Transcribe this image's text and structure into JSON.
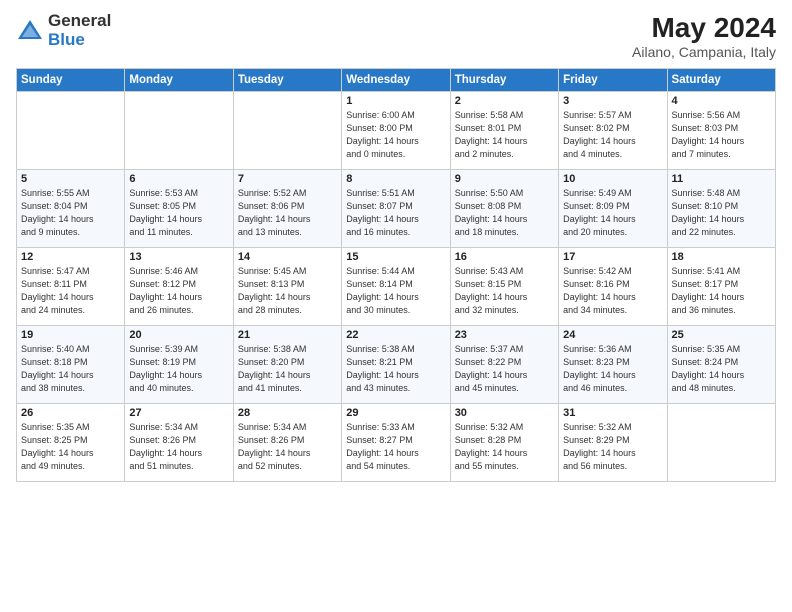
{
  "logo": {
    "general": "General",
    "blue": "Blue"
  },
  "title": "May 2024",
  "subtitle": "Ailano, Campania, Italy",
  "days_of_week": [
    "Sunday",
    "Monday",
    "Tuesday",
    "Wednesday",
    "Thursday",
    "Friday",
    "Saturday"
  ],
  "weeks": [
    [
      {
        "day": "",
        "info": ""
      },
      {
        "day": "",
        "info": ""
      },
      {
        "day": "",
        "info": ""
      },
      {
        "day": "1",
        "info": "Sunrise: 6:00 AM\nSunset: 8:00 PM\nDaylight: 14 hours\nand 0 minutes."
      },
      {
        "day": "2",
        "info": "Sunrise: 5:58 AM\nSunset: 8:01 PM\nDaylight: 14 hours\nand 2 minutes."
      },
      {
        "day": "3",
        "info": "Sunrise: 5:57 AM\nSunset: 8:02 PM\nDaylight: 14 hours\nand 4 minutes."
      },
      {
        "day": "4",
        "info": "Sunrise: 5:56 AM\nSunset: 8:03 PM\nDaylight: 14 hours\nand 7 minutes."
      }
    ],
    [
      {
        "day": "5",
        "info": "Sunrise: 5:55 AM\nSunset: 8:04 PM\nDaylight: 14 hours\nand 9 minutes."
      },
      {
        "day": "6",
        "info": "Sunrise: 5:53 AM\nSunset: 8:05 PM\nDaylight: 14 hours\nand 11 minutes."
      },
      {
        "day": "7",
        "info": "Sunrise: 5:52 AM\nSunset: 8:06 PM\nDaylight: 14 hours\nand 13 minutes."
      },
      {
        "day": "8",
        "info": "Sunrise: 5:51 AM\nSunset: 8:07 PM\nDaylight: 14 hours\nand 16 minutes."
      },
      {
        "day": "9",
        "info": "Sunrise: 5:50 AM\nSunset: 8:08 PM\nDaylight: 14 hours\nand 18 minutes."
      },
      {
        "day": "10",
        "info": "Sunrise: 5:49 AM\nSunset: 8:09 PM\nDaylight: 14 hours\nand 20 minutes."
      },
      {
        "day": "11",
        "info": "Sunrise: 5:48 AM\nSunset: 8:10 PM\nDaylight: 14 hours\nand 22 minutes."
      }
    ],
    [
      {
        "day": "12",
        "info": "Sunrise: 5:47 AM\nSunset: 8:11 PM\nDaylight: 14 hours\nand 24 minutes."
      },
      {
        "day": "13",
        "info": "Sunrise: 5:46 AM\nSunset: 8:12 PM\nDaylight: 14 hours\nand 26 minutes."
      },
      {
        "day": "14",
        "info": "Sunrise: 5:45 AM\nSunset: 8:13 PM\nDaylight: 14 hours\nand 28 minutes."
      },
      {
        "day": "15",
        "info": "Sunrise: 5:44 AM\nSunset: 8:14 PM\nDaylight: 14 hours\nand 30 minutes."
      },
      {
        "day": "16",
        "info": "Sunrise: 5:43 AM\nSunset: 8:15 PM\nDaylight: 14 hours\nand 32 minutes."
      },
      {
        "day": "17",
        "info": "Sunrise: 5:42 AM\nSunset: 8:16 PM\nDaylight: 14 hours\nand 34 minutes."
      },
      {
        "day": "18",
        "info": "Sunrise: 5:41 AM\nSunset: 8:17 PM\nDaylight: 14 hours\nand 36 minutes."
      }
    ],
    [
      {
        "day": "19",
        "info": "Sunrise: 5:40 AM\nSunset: 8:18 PM\nDaylight: 14 hours\nand 38 minutes."
      },
      {
        "day": "20",
        "info": "Sunrise: 5:39 AM\nSunset: 8:19 PM\nDaylight: 14 hours\nand 40 minutes."
      },
      {
        "day": "21",
        "info": "Sunrise: 5:38 AM\nSunset: 8:20 PM\nDaylight: 14 hours\nand 41 minutes."
      },
      {
        "day": "22",
        "info": "Sunrise: 5:38 AM\nSunset: 8:21 PM\nDaylight: 14 hours\nand 43 minutes."
      },
      {
        "day": "23",
        "info": "Sunrise: 5:37 AM\nSunset: 8:22 PM\nDaylight: 14 hours\nand 45 minutes."
      },
      {
        "day": "24",
        "info": "Sunrise: 5:36 AM\nSunset: 8:23 PM\nDaylight: 14 hours\nand 46 minutes."
      },
      {
        "day": "25",
        "info": "Sunrise: 5:35 AM\nSunset: 8:24 PM\nDaylight: 14 hours\nand 48 minutes."
      }
    ],
    [
      {
        "day": "26",
        "info": "Sunrise: 5:35 AM\nSunset: 8:25 PM\nDaylight: 14 hours\nand 49 minutes."
      },
      {
        "day": "27",
        "info": "Sunrise: 5:34 AM\nSunset: 8:26 PM\nDaylight: 14 hours\nand 51 minutes."
      },
      {
        "day": "28",
        "info": "Sunrise: 5:34 AM\nSunset: 8:26 PM\nDaylight: 14 hours\nand 52 minutes."
      },
      {
        "day": "29",
        "info": "Sunrise: 5:33 AM\nSunset: 8:27 PM\nDaylight: 14 hours\nand 54 minutes."
      },
      {
        "day": "30",
        "info": "Sunrise: 5:32 AM\nSunset: 8:28 PM\nDaylight: 14 hours\nand 55 minutes."
      },
      {
        "day": "31",
        "info": "Sunrise: 5:32 AM\nSunset: 8:29 PM\nDaylight: 14 hours\nand 56 minutes."
      },
      {
        "day": "",
        "info": ""
      }
    ]
  ]
}
